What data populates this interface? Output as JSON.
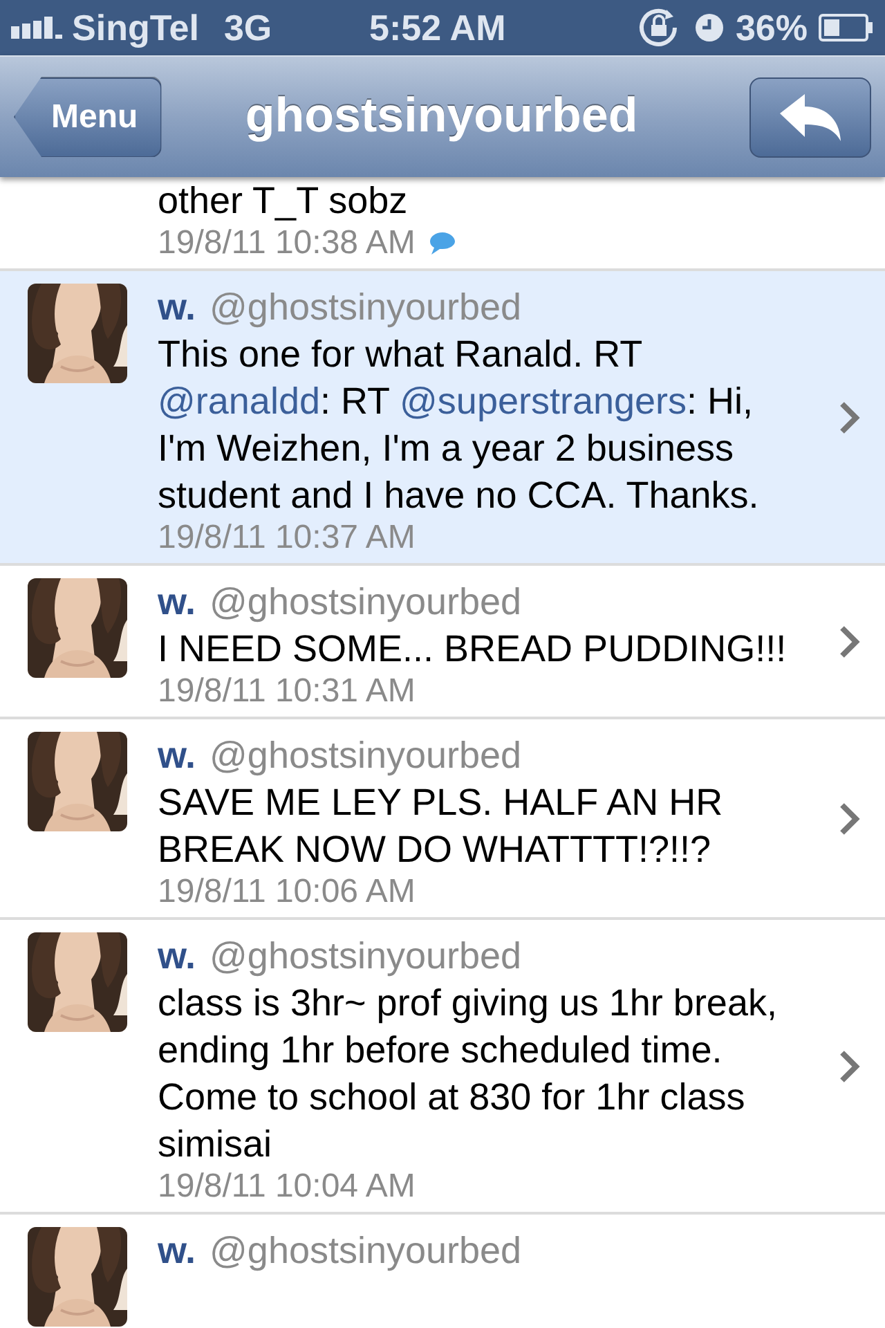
{
  "status_bar": {
    "carrier": "SingTel",
    "network": "3G",
    "time": "5:52 AM",
    "battery": "36%"
  },
  "nav": {
    "back": "Menu",
    "title": "ghostsinyourbed"
  },
  "tweets": [
    {
      "body": [
        {
          "kind": "plain",
          "text": "other T_T sobz"
        }
      ],
      "time": "19/8/11 10:38 AM",
      "conversation": true,
      "selected": false,
      "chevron": false
    },
    {
      "name": "w.",
      "handle": "@ghostsinyourbed",
      "body": [
        {
          "kind": "plain",
          "text": "This one for what Ranald. RT "
        },
        {
          "kind": "mention",
          "text": "@ranaldd"
        },
        {
          "kind": "plain",
          "text": ": RT "
        },
        {
          "kind": "mention",
          "text": "@superstrangers"
        },
        {
          "kind": "plain",
          "text": ": Hi, I'm Weizhen, I'm a year 2 business student and I have no CCA. Thanks."
        }
      ],
      "time": "19/8/11 10:37 AM",
      "conversation": false,
      "selected": true,
      "chevron": true
    },
    {
      "name": "w.",
      "handle": "@ghostsinyourbed",
      "body": [
        {
          "kind": "plain",
          "text": "I NEED SOME... BREAD PUDDING!!!"
        }
      ],
      "time": "19/8/11 10:31 AM",
      "conversation": false,
      "selected": false,
      "chevron": true
    },
    {
      "name": "w.",
      "handle": "@ghostsinyourbed",
      "body": [
        {
          "kind": "plain",
          "text": "SAVE ME LEY PLS. HALF AN HR BREAK NOW DO WHATTTT!?!!?"
        }
      ],
      "time": "19/8/11 10:06 AM",
      "conversation": false,
      "selected": false,
      "chevron": true
    },
    {
      "name": "w.",
      "handle": "@ghostsinyourbed",
      "body": [
        {
          "kind": "plain",
          "text": "class is 3hr~ prof giving us 1hr break, ending 1hr before scheduled time. Come to school at 830 for 1hr class simisai"
        }
      ],
      "time": "19/8/11 10:04 AM",
      "conversation": false,
      "selected": false,
      "chevron": true
    },
    {
      "name": "w.",
      "handle": "@ghostsinyourbed",
      "selected": false,
      "chevron": false
    }
  ]
}
